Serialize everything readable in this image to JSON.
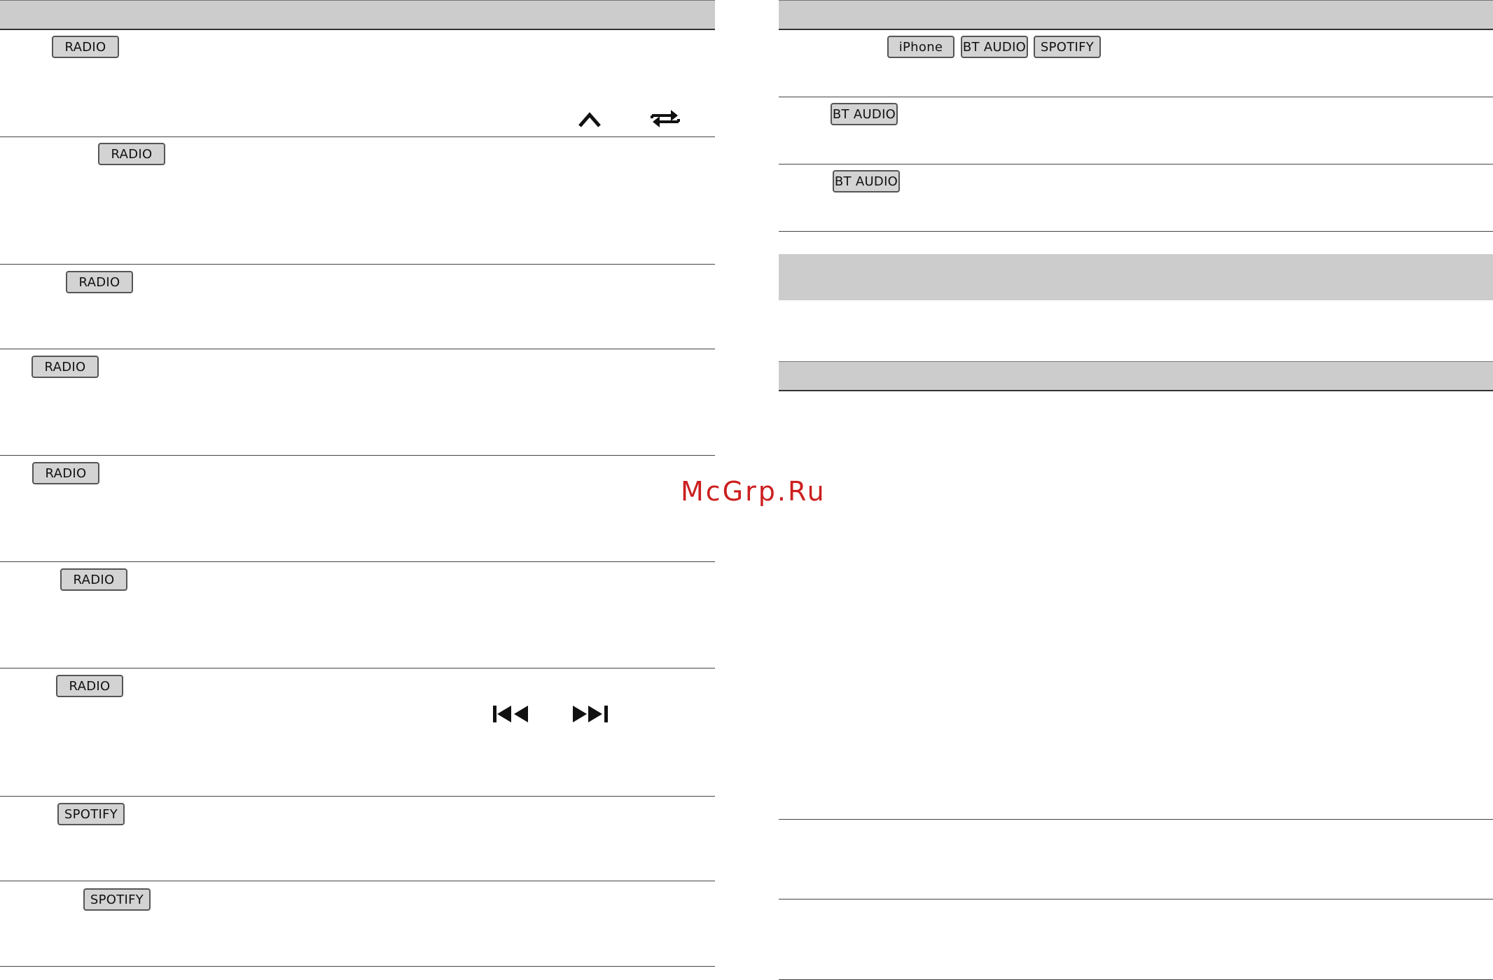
{
  "tags": {
    "radio": "RADIO",
    "spotify": "SPOTIFY",
    "iphone": "iPhone",
    "bt_audio": "BT AUDIO"
  },
  "icons": [
    "up-chevron-icon",
    "repeat-icon",
    "previous-track-icon",
    "next-track-icon"
  ],
  "watermark": "McGrp.Ru",
  "colors": {
    "header": "#cccccc",
    "tag_fill": "#d3d3d3",
    "watermark": "#cc1f1f"
  }
}
